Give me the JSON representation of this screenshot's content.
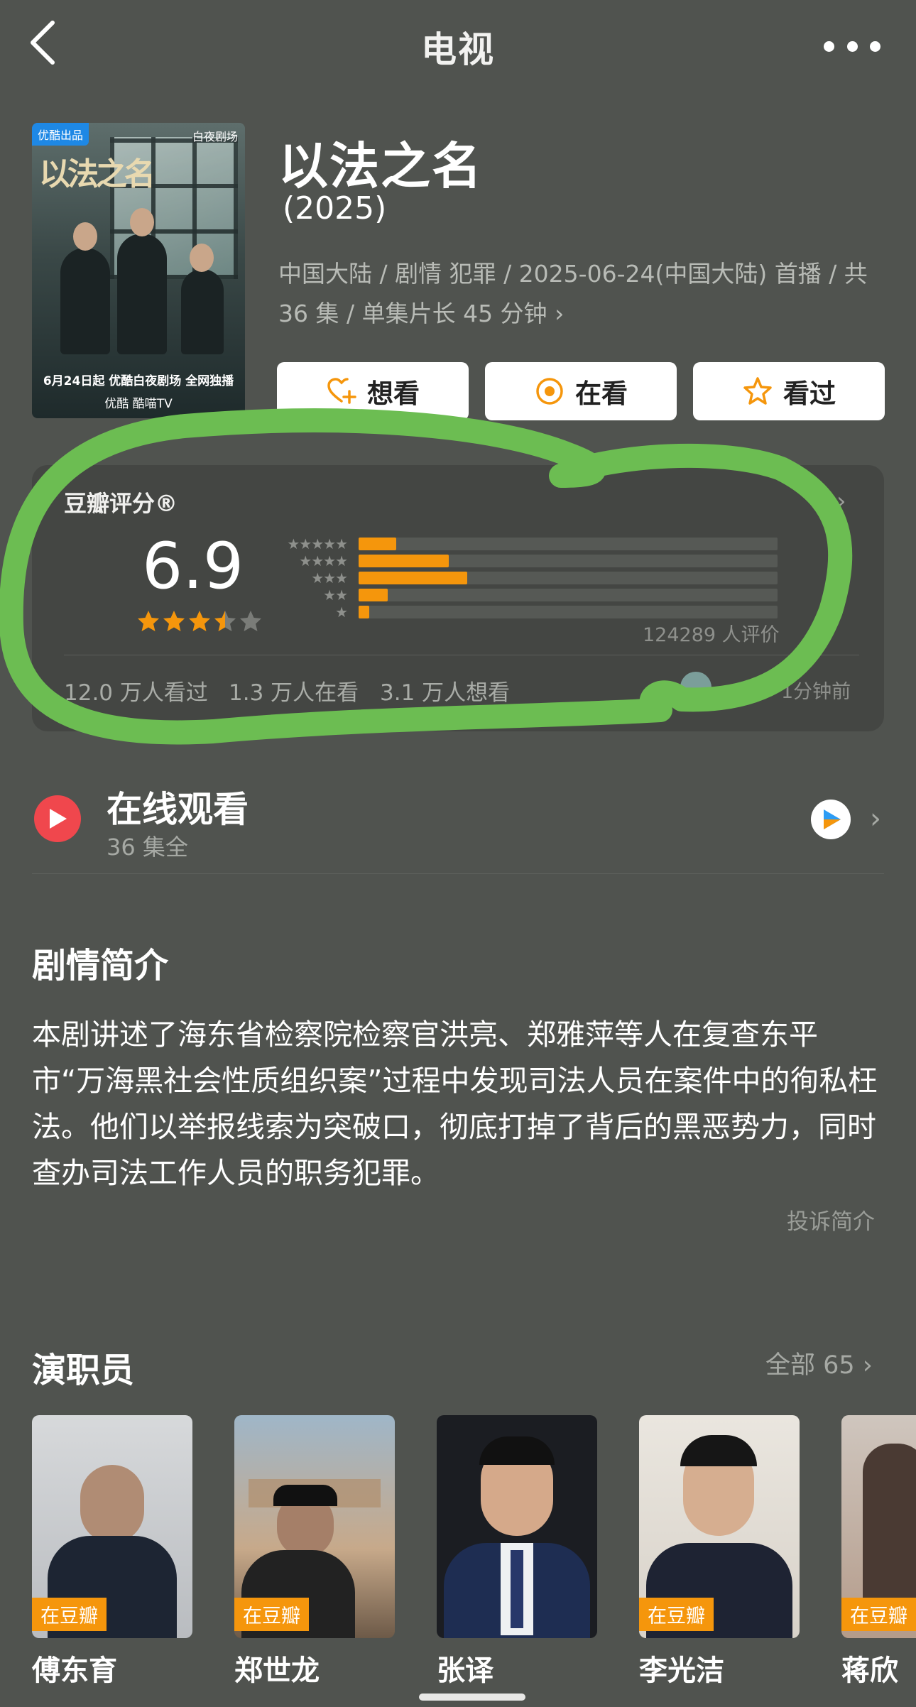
{
  "topbar": {
    "title": "电视"
  },
  "poster": {
    "badge": "优酷出品",
    "logo": "白夜剧场",
    "calligraphy": "以法之名",
    "release": "6月24日起 优酷白夜剧场 全网独播",
    "platforms": "优酷  酷喵TV"
  },
  "show": {
    "title": "以法之名",
    "year": "(2025)",
    "meta_line1": "中国大陆 / 剧情 犯罪 / 2025-06-24(中国大陆) 首播 / 共",
    "meta_line2": "36 集 / 单集片长 45 分钟"
  },
  "actions": [
    {
      "label": "想看",
      "icon": "heart-plus-icon"
    },
    {
      "label": "在看",
      "icon": "target-icon"
    },
    {
      "label": "看过",
      "icon": "star-outline-icon"
    }
  ],
  "rating": {
    "header": "豆瓣评分®",
    "score": "6.9",
    "stars": 3.5,
    "count_text": "124289 人评价",
    "distribution": [
      {
        "stars": 5,
        "label": "★★★★★",
        "fraction": 0.09
      },
      {
        "stars": 4,
        "label": "★★★★",
        "fraction": 0.215
      },
      {
        "stars": 3,
        "label": "★★★",
        "fraction": 0.26
      },
      {
        "stars": 2,
        "label": "★★",
        "fraction": 0.07
      },
      {
        "stars": 1,
        "label": "★",
        "fraction": 0.025
      }
    ],
    "stats": {
      "watched": "12.0 万人看过",
      "watching": "1.3 万人在看",
      "want": "3.1 万人想看"
    },
    "updated": "1分钟前",
    "accent_color": "#f5960c"
  },
  "online": {
    "title": "在线观看",
    "subtitle": "36 集全"
  },
  "synopsis": {
    "title": "剧情简介",
    "text": "本剧讲述了海东省检察院检察官洪亮、郑雅萍等人在复查东平市“万海黑社会性质组织案”过程中发现司法人员在案件中的徇私枉法。他们以举报线索为突破口，彻底打掉了背后的黑恶势力，同时查办司法工作人员的职务犯罪。",
    "report": "投诉简介"
  },
  "cast": {
    "title": "演职员",
    "all_label": "全部 65",
    "members": [
      {
        "name": "傅东育",
        "badge": "在豆瓣"
      },
      {
        "name": "郑世龙",
        "badge": "在豆瓣"
      },
      {
        "name": "张译",
        "badge": ""
      },
      {
        "name": "李光洁",
        "badge": "在豆瓣"
      },
      {
        "name": "蒋欣",
        "badge": "在豆瓣"
      }
    ]
  }
}
